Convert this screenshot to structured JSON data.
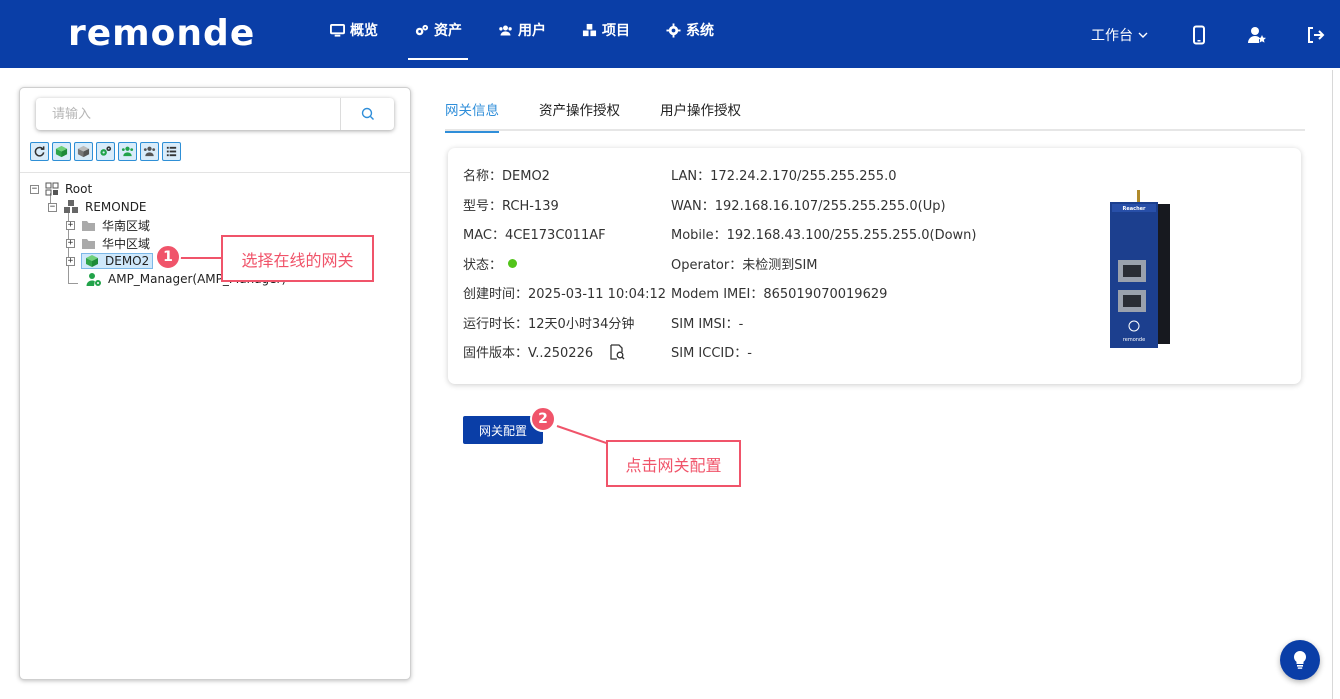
{
  "brand": {
    "logo_text": "remonde"
  },
  "nav": [
    {
      "label": "概览",
      "icon": "monitor-icon"
    },
    {
      "label": "资产",
      "icon": "gears-icon"
    },
    {
      "label": "用户",
      "icon": "users-icon"
    },
    {
      "label": "项目",
      "icon": "cubes-icon"
    },
    {
      "label": "系统",
      "icon": "gear-icon"
    }
  ],
  "header": {
    "workbench": "工作台"
  },
  "search": {
    "placeholder": "请输入"
  },
  "tree": {
    "root": "Root",
    "org": "REMONDE",
    "region1": "华南区域",
    "region2": "华中区域",
    "device": "DEMO2",
    "user": "AMP_Manager(AMP_Manager)"
  },
  "callouts": {
    "one_num": "1",
    "one_text": "选择在线的网关",
    "two_num": "2",
    "two_text": "点击网关配置"
  },
  "tabs": [
    "网关信息",
    "资产操作授权",
    "用户操作授权"
  ],
  "info": {
    "name": "名称：DEMO2",
    "model": "型号：RCH-139",
    "mac": "MAC：4CE173C011AF",
    "status_label": "状态：",
    "status_color": "#52c41a",
    "created": "创建时间：2025-03-11 10:04:12",
    "uptime": "运行时长：12天0小时34分钟",
    "firmware": "固件版本：V..250226",
    "lan": "LAN：172.24.2.170/255.255.255.0",
    "wan": "WAN：192.168.16.107/255.255.255.0(Up)",
    "mobile": "Mobile：192.168.43.100/255.255.255.0(Down)",
    "operator": "Operator：未检测到SIM",
    "imei": "Modem IMEI：865019070019629",
    "imsi": "SIM IMSI：-",
    "iccid": "SIM ICCID：-"
  },
  "device_label": {
    "brand": "Reacher",
    "logo": "remonde"
  },
  "buttons": {
    "gateway_config": "网关配置"
  },
  "colors": {
    "primary": "#0a3ea7",
    "accent": "#2f8ed9",
    "callout": "#f0546a"
  }
}
